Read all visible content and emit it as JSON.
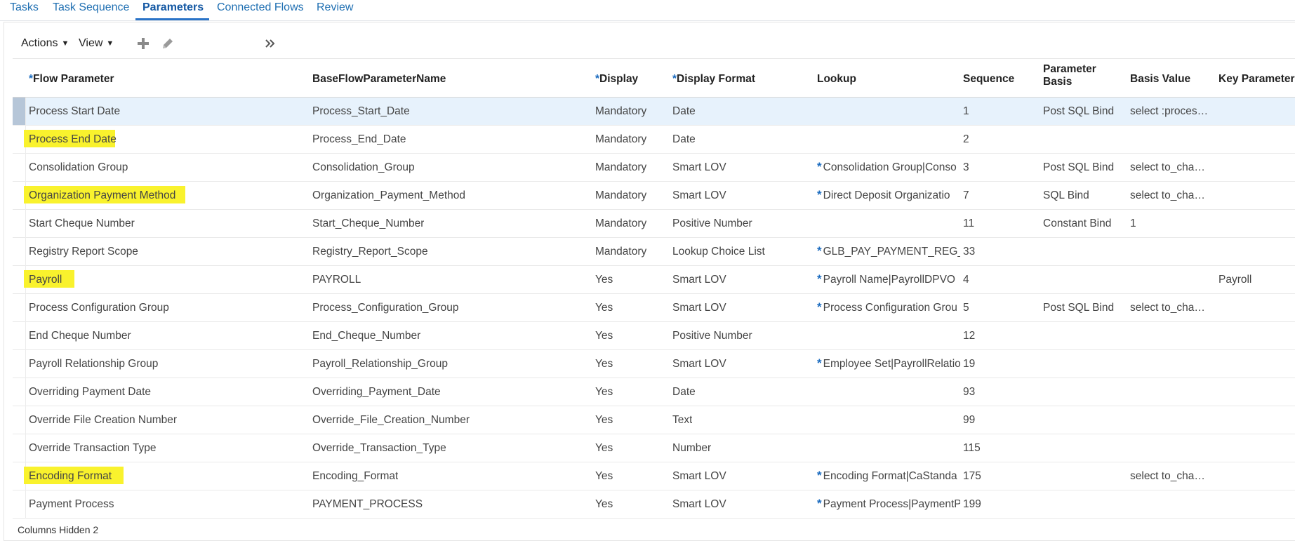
{
  "tabs": [
    {
      "label": "Tasks"
    },
    {
      "label": "Task Sequence"
    },
    {
      "label": "Parameters"
    },
    {
      "label": "Connected Flows"
    },
    {
      "label": "Review"
    }
  ],
  "toolbar": {
    "actions_label": "Actions",
    "view_label": "View",
    "caret": "▼",
    "add_icon": "plus-icon",
    "edit_icon": "pencil-icon",
    "expand_icon": "double-chevron-right-icon"
  },
  "columns": {
    "required_marker": "*",
    "flow_parameter": "Flow Parameter",
    "base_name": "BaseFlowParameterName",
    "display": "Display",
    "display_format": "Display Format",
    "lookup": "Lookup",
    "sequence": "Sequence",
    "parameter_basis_1": "Parameter",
    "parameter_basis_2": "Basis",
    "basis_value": "Basis Value",
    "key_parameter": "Key Parameter"
  },
  "rows": [
    {
      "flow_parameter": "Process Start Date",
      "base_name": "Process_Start_Date",
      "display": "Mandatory",
      "display_format": "Date",
      "lookup": "",
      "sequence": "1",
      "basis": "Post SQL Bind",
      "basis_value": "select :proces…",
      "key_parameter": "",
      "highlighted": false,
      "selected": true
    },
    {
      "flow_parameter": "Process End Date",
      "base_name": "Process_End_Date",
      "display": "Mandatory",
      "display_format": "Date",
      "lookup": "",
      "sequence": "2",
      "basis": "",
      "basis_value": "",
      "key_parameter": "",
      "highlighted": true,
      "selected": false
    },
    {
      "flow_parameter": "Consolidation Group",
      "base_name": "Consolidation_Group",
      "display": "Mandatory",
      "display_format": "Smart LOV",
      "lookup": "Consolidation Group|Conso",
      "sequence": "3",
      "basis": "Post SQL Bind",
      "basis_value": "select to_cha…",
      "key_parameter": "",
      "highlighted": false,
      "selected": false
    },
    {
      "flow_parameter": "Organization Payment Method",
      "base_name": "Organization_Payment_Method",
      "display": "Mandatory",
      "display_format": "Smart LOV",
      "lookup": "Direct Deposit Organizatio",
      "sequence": "7",
      "basis": "SQL Bind",
      "basis_value": "select to_cha…",
      "key_parameter": "",
      "highlighted": true,
      "selected": false
    },
    {
      "flow_parameter": "Start Cheque Number",
      "base_name": "Start_Cheque_Number",
      "display": "Mandatory",
      "display_format": "Positive Number",
      "lookup": "",
      "sequence": "11",
      "basis": "Constant Bind",
      "basis_value": "1",
      "key_parameter": "",
      "highlighted": false,
      "selected": false
    },
    {
      "flow_parameter": "Registry Report Scope",
      "base_name": "Registry_Report_Scope",
      "display": "Mandatory",
      "display_format": "Lookup Choice List",
      "lookup": "GLB_PAY_PAYMENT_REG_RE",
      "sequence": "33",
      "basis": "",
      "basis_value": "",
      "key_parameter": "",
      "highlighted": false,
      "selected": false
    },
    {
      "flow_parameter": "Payroll",
      "base_name": "PAYROLL",
      "display": "Yes",
      "display_format": "Smart LOV",
      "lookup": "Payroll Name|PayrollDPVO",
      "sequence": "4",
      "basis": "",
      "basis_value": "",
      "key_parameter": "Payroll",
      "highlighted": true,
      "selected": false
    },
    {
      "flow_parameter": "Process Configuration Group",
      "base_name": "Process_Configuration_Group",
      "display": "Yes",
      "display_format": "Smart LOV",
      "lookup": "Process Configuration Grou",
      "sequence": "5",
      "basis": "Post SQL Bind",
      "basis_value": "select to_cha…",
      "key_parameter": "",
      "highlighted": false,
      "selected": false
    },
    {
      "flow_parameter": "End Cheque Number",
      "base_name": "End_Cheque_Number",
      "display": "Yes",
      "display_format": "Positive Number",
      "lookup": "",
      "sequence": "12",
      "basis": "",
      "basis_value": "",
      "key_parameter": "",
      "highlighted": false,
      "selected": false
    },
    {
      "flow_parameter": "Payroll Relationship Group",
      "base_name": "Payroll_Relationship_Group",
      "display": "Yes",
      "display_format": "Smart LOV",
      "lookup": "Employee Set|PayrollRelatio",
      "sequence": "19",
      "basis": "",
      "basis_value": "",
      "key_parameter": "",
      "highlighted": false,
      "selected": false
    },
    {
      "flow_parameter": "Overriding Payment Date",
      "base_name": "Overriding_Payment_Date",
      "display": "Yes",
      "display_format": "Date",
      "lookup": "",
      "sequence": "93",
      "basis": "",
      "basis_value": "",
      "key_parameter": "",
      "highlighted": false,
      "selected": false
    },
    {
      "flow_parameter": "Override File Creation Number",
      "base_name": "Override_File_Creation_Number",
      "display": "Yes",
      "display_format": "Text",
      "lookup": "",
      "sequence": "99",
      "basis": "",
      "basis_value": "",
      "key_parameter": "",
      "highlighted": false,
      "selected": false
    },
    {
      "flow_parameter": "Override Transaction Type",
      "base_name": "Override_Transaction_Type",
      "display": "Yes",
      "display_format": "Number",
      "lookup": "",
      "sequence": "115",
      "basis": "",
      "basis_value": "",
      "key_parameter": "",
      "highlighted": false,
      "selected": false
    },
    {
      "flow_parameter": "Encoding Format",
      "base_name": "Encoding_Format",
      "display": "Yes",
      "display_format": "Smart LOV",
      "lookup": "Encoding Format|CaStanda",
      "sequence": "175",
      "basis": "",
      "basis_value": "select to_cha…",
      "key_parameter": "",
      "highlighted": true,
      "selected": false
    },
    {
      "flow_parameter": "Payment Process",
      "base_name": "PAYMENT_PROCESS",
      "display": "Yes",
      "display_format": "Smart LOV",
      "lookup": "Payment Process|PaymentP",
      "sequence": "199",
      "basis": "",
      "basis_value": "",
      "key_parameter": "",
      "highlighted": false,
      "selected": false
    }
  ],
  "footer": {
    "text": "Columns Hidden  2"
  },
  "colors": {
    "link": "#1f6fb2",
    "highlight": "#f9f22d",
    "selected_row": "#e7f2fc",
    "required": "#1a6bbf"
  }
}
